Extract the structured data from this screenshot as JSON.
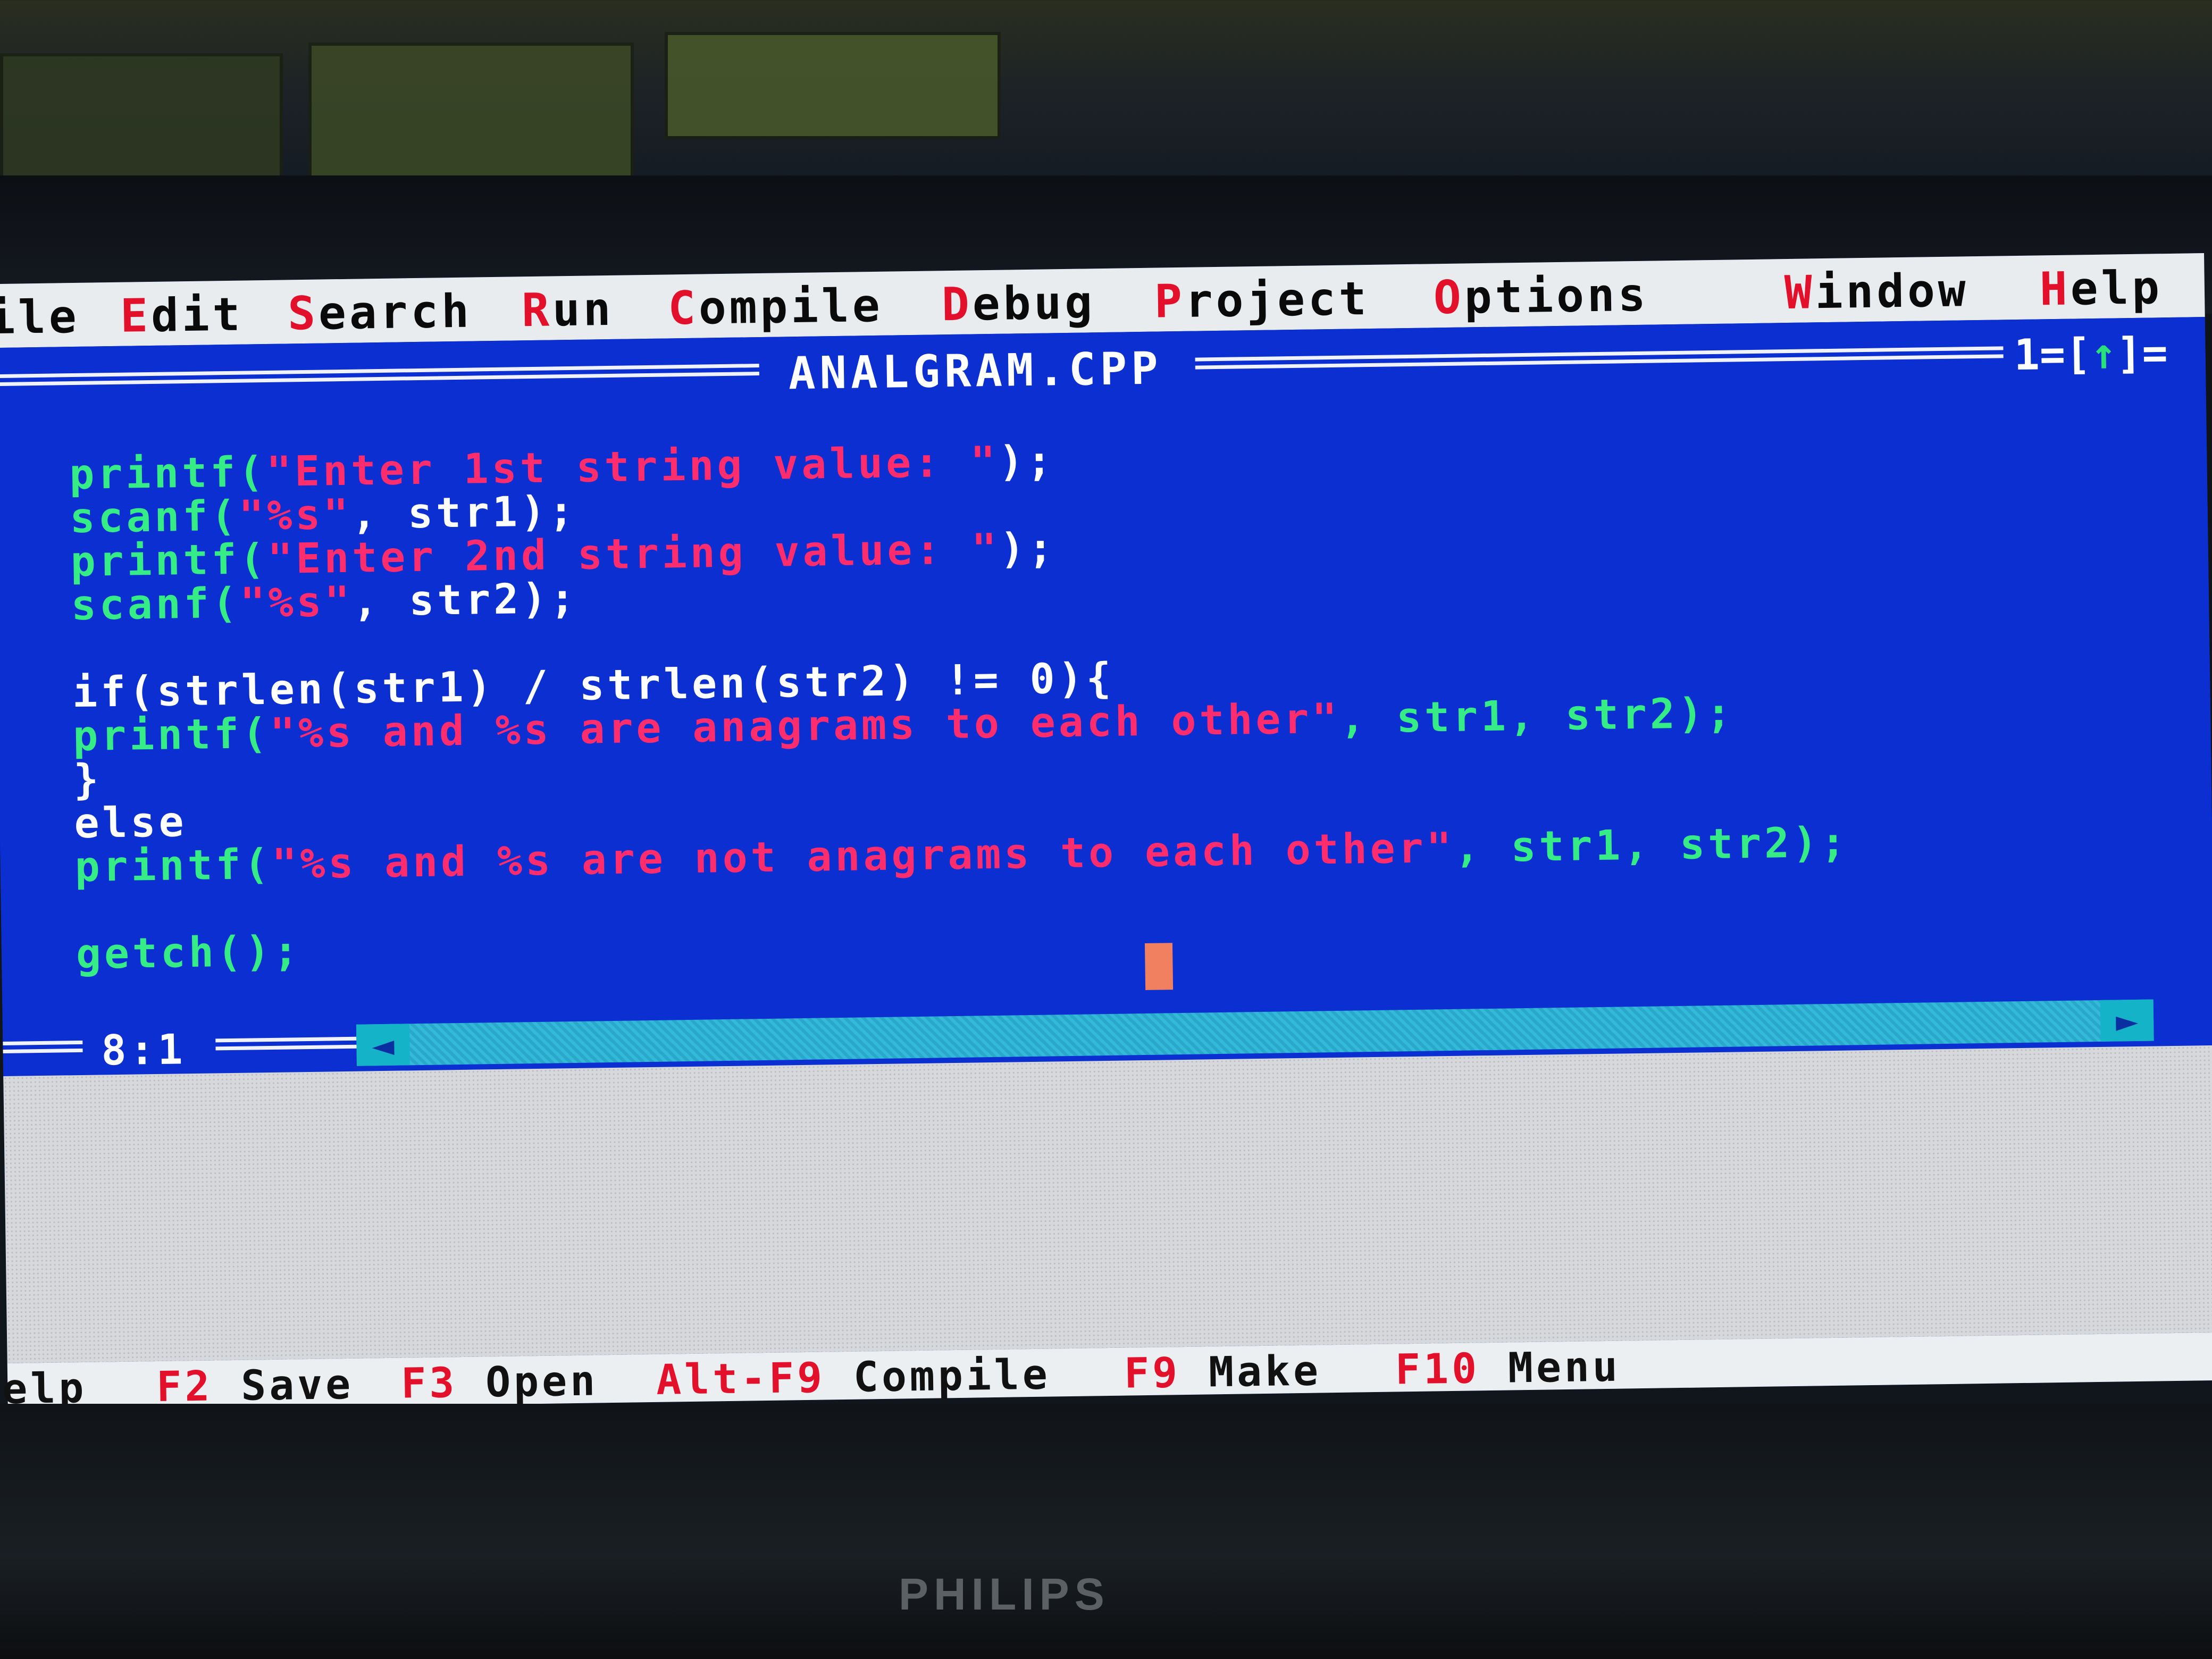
{
  "menu": {
    "items": [
      {
        "label": "ile",
        "hot": "",
        "rest": "ile"
      },
      {
        "label": "Edit",
        "hot": "E",
        "rest": "dit"
      },
      {
        "label": "Search",
        "hot": "S",
        "rest": "earch"
      },
      {
        "label": "Run",
        "hot": "R",
        "rest": "un"
      },
      {
        "label": "Compile",
        "hot": "C",
        "rest": "ompile"
      },
      {
        "label": "Debug",
        "hot": "D",
        "rest": "ebug"
      },
      {
        "label": "Project",
        "hot": "P",
        "rest": "roject"
      },
      {
        "label": "Options",
        "hot": "O",
        "rest": "ptions"
      },
      {
        "label": "Window",
        "hot": "W",
        "rest": "indow"
      },
      {
        "label": "Help",
        "hot": "H",
        "rest": "elp"
      }
    ]
  },
  "editor": {
    "filename": "ANALGRAM.CPP",
    "window_number": "1",
    "window_marker_open": "=[",
    "window_marker_arrow": "↑",
    "window_marker_close": "]="
  },
  "code_lines": [
    [
      {
        "t": "printf(",
        "c": "g"
      },
      {
        "t": "\"Enter 1st string value: \"",
        "c": "s"
      },
      {
        "t": ");",
        "c": "w"
      }
    ],
    [
      {
        "t": "scanf(",
        "c": "g"
      },
      {
        "t": "\"%s\"",
        "c": "s"
      },
      {
        "t": ", str1);",
        "c": "w"
      }
    ],
    [
      {
        "t": "printf(",
        "c": "g"
      },
      {
        "t": "\"Enter 2nd string value: \"",
        "c": "s"
      },
      {
        "t": ");",
        "c": "w"
      }
    ],
    [
      {
        "t": "scanf(",
        "c": "g"
      },
      {
        "t": "\"%s\"",
        "c": "s"
      },
      {
        "t": ", str2);",
        "c": "w"
      }
    ],
    [],
    [
      {
        "t": "if(strlen(str1) / strlen(str2) != 0){",
        "c": "w"
      }
    ],
    [
      {
        "t": "printf(",
        "c": "g"
      },
      {
        "t": "\"%s and %s are anagrams to each other\"",
        "c": "s"
      },
      {
        "t": ", str1, str2);",
        "c": "g"
      }
    ],
    [
      {
        "t": "}",
        "c": "w"
      }
    ],
    [
      {
        "t": "else",
        "c": "w"
      }
    ],
    [
      {
        "t": "printf(",
        "c": "g"
      },
      {
        "t": "\"%s and %s are not anagrams to each other\"",
        "c": "s"
      },
      {
        "t": ", str1, str2);",
        "c": "g"
      }
    ],
    [],
    [
      {
        "t": "getch();",
        "c": "g"
      }
    ]
  ],
  "status": {
    "cursor_position": "8:1"
  },
  "hints": [
    {
      "key": "",
      "label": "elp"
    },
    {
      "key": "F2",
      "label": "Save"
    },
    {
      "key": "F3",
      "label": "Open"
    },
    {
      "key": "Alt-F9",
      "label": "Compile"
    },
    {
      "key": "F9",
      "label": "Make"
    },
    {
      "key": "F10",
      "label": "Menu"
    }
  ],
  "monitor": {
    "brand": "PHILIPS"
  },
  "colors": {
    "editor_bg": "#0b2fd0",
    "keyword": "#35ec86",
    "string": "#ff2d6e",
    "menu_hotkey": "#e2102a"
  }
}
